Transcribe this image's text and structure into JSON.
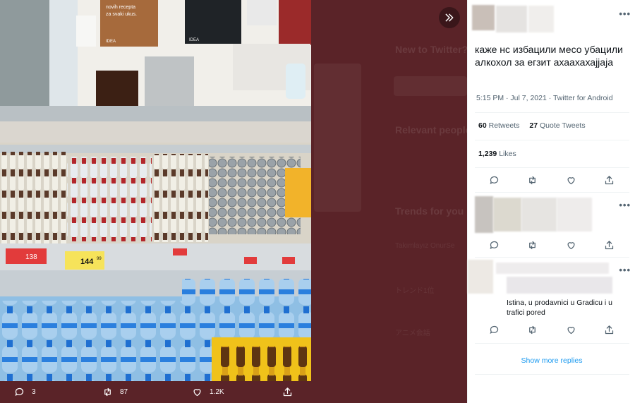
{
  "background_ghost": {
    "new_to_twitter": "New to Twitter?",
    "relevant_people": "Relevant people",
    "trends": "Trends for you",
    "trend_1": "Takımlayız OnurSe",
    "trend_2": "トレンド1位",
    "trend_3": "アニメ会話"
  },
  "photo": {
    "sign_line_1": "novih recepta",
    "sign_line_2": "za svaki ukus.",
    "sign_brand": "IDEA",
    "price_1": "138",
    "price_2": "144",
    "price_decimals": "99"
  },
  "viewer_actions": {
    "replies": "3",
    "retweets": "87",
    "likes": "1.2K"
  },
  "tweet": {
    "text": "каже нс избацили месо убацили алкохол за егзит ахаахахајјаја",
    "meta": "5:15 PM · Jul 7, 2021 · Twitter for Android",
    "retweets_count": "60",
    "retweets_label": "Retweets",
    "quotes_count": "27",
    "quotes_label": "Quote Tweets",
    "likes_count": "1,239",
    "likes_label": "Likes"
  },
  "replies": [
    {
      "text": ""
    },
    {
      "text": "Istina, u prodavnici u Gradicu i u trafici pored"
    }
  ],
  "show_more": "Show more replies",
  "more_glyph": "•••",
  "colors": {
    "accent": "#1d9bf0",
    "viewer_bg": "#5a2328",
    "muted": "#536471"
  }
}
